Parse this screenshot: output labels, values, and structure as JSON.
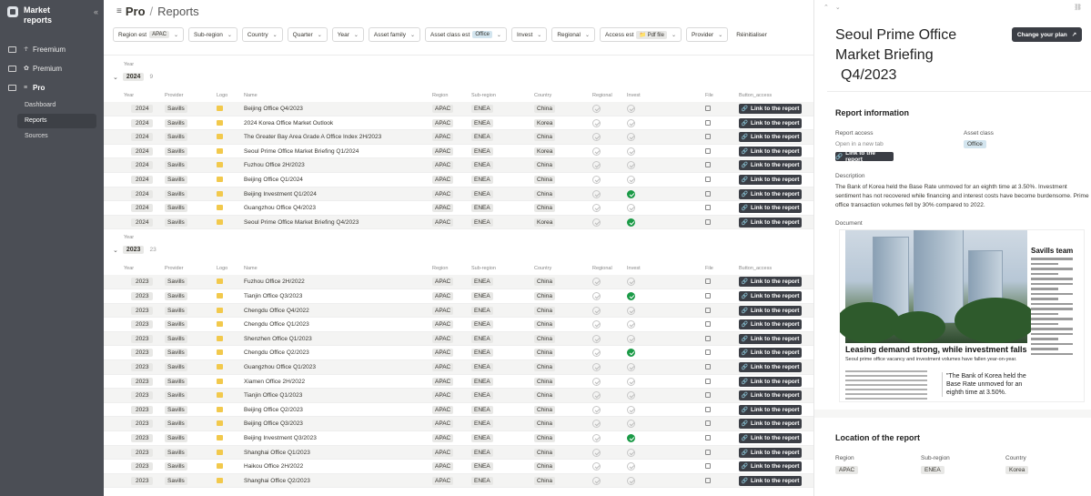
{
  "sidebar": {
    "title": "Market reports",
    "items": [
      {
        "label": "Freemium"
      },
      {
        "label": "Premium"
      },
      {
        "label": "Pro"
      }
    ],
    "subitems": [
      {
        "label": "Dashboard"
      },
      {
        "label": "Reports"
      },
      {
        "label": "Sources"
      }
    ]
  },
  "header": {
    "section": "Pro",
    "separator": "/",
    "page": "Reports"
  },
  "filters": [
    {
      "label": "Region est",
      "value": "APAC",
      "value_color": "gray"
    },
    {
      "label": "Sub-region",
      "value": ""
    },
    {
      "label": "Country",
      "value": ""
    },
    {
      "label": "Quarter",
      "value": ""
    },
    {
      "label": "Year",
      "value": ""
    },
    {
      "label": "Asset family",
      "value": ""
    },
    {
      "label": "Asset class est",
      "value": "Office",
      "value_color": "blue"
    },
    {
      "label": "Invest",
      "value": ""
    },
    {
      "label": "Regional",
      "value": ""
    },
    {
      "label": "Access est",
      "value": "📁 Pdf file",
      "value_color": "gray"
    },
    {
      "label": "Provider",
      "value": ""
    }
  ],
  "reset_label": "Réinitialiser",
  "columns": {
    "year": "Year",
    "provider": "Provider",
    "logo": "Logo",
    "name": "Name",
    "region": "Region",
    "subregion": "Sub-region",
    "country": "Country",
    "regional": "Regional",
    "invest": "Invest",
    "file": "File",
    "button": "Button_access"
  },
  "group_label": "Year",
  "button_label": "Link to the report",
  "groups": [
    {
      "year": "2024",
      "count": "9",
      "rows": [
        {
          "year": "2024",
          "provider": "Savills",
          "name": "Beijing Office Q4/2023",
          "region": "APAC",
          "subregion": "ENEA",
          "country": "China",
          "invest": false
        },
        {
          "year": "2024",
          "provider": "Savills",
          "name": "2024 Korea Office Market Outlook",
          "region": "APAC",
          "subregion": "ENEA",
          "country": "Korea",
          "invest": false
        },
        {
          "year": "2024",
          "provider": "Savills",
          "name": "The Greater Bay Area Grade A Office Index 2H/2023",
          "region": "APAC",
          "subregion": "ENEA",
          "country": "China",
          "invest": false
        },
        {
          "year": "2024",
          "provider": "Savills",
          "name": "Seoul Prime Office Market Briefing Q1/2024",
          "region": "APAC",
          "subregion": "ENEA",
          "country": "Korea",
          "invest": false
        },
        {
          "year": "2024",
          "provider": "Savills",
          "name": "Fuzhou Office 2H/2023",
          "region": "APAC",
          "subregion": "ENEA",
          "country": "China",
          "invest": false
        },
        {
          "year": "2024",
          "provider": "Savills",
          "name": "Beijing Office Q1/2024",
          "region": "APAC",
          "subregion": "ENEA",
          "country": "China",
          "invest": false
        },
        {
          "year": "2024",
          "provider": "Savills",
          "name": "Beijing Investment Q1/2024",
          "region": "APAC",
          "subregion": "ENEA",
          "country": "China",
          "invest": true
        },
        {
          "year": "2024",
          "provider": "Savills",
          "name": "Guangzhou Office Q4/2023",
          "region": "APAC",
          "subregion": "ENEA",
          "country": "China",
          "invest": false
        },
        {
          "year": "2024",
          "provider": "Savills",
          "name": "Seoul Prime Office Market Briefing Q4/2023",
          "region": "APAC",
          "subregion": "ENEA",
          "country": "Korea",
          "invest": true,
          "selected": true
        }
      ]
    },
    {
      "year": "2023",
      "count": "23",
      "rows": [
        {
          "year": "2023",
          "provider": "Savills",
          "name": "Fuzhou Office 2H/2022",
          "region": "APAC",
          "subregion": "ENEA",
          "country": "China",
          "invest": false
        },
        {
          "year": "2023",
          "provider": "Savills",
          "name": "Tianjin Office Q3/2023",
          "region": "APAC",
          "subregion": "ENEA",
          "country": "China",
          "invest": true
        },
        {
          "year": "2023",
          "provider": "Savills",
          "name": "Chengdu Office Q4/2022",
          "region": "APAC",
          "subregion": "ENEA",
          "country": "China",
          "invest": false
        },
        {
          "year": "2023",
          "provider": "Savills",
          "name": "Chengdu Office Q1/2023",
          "region": "APAC",
          "subregion": "ENEA",
          "country": "China",
          "invest": false
        },
        {
          "year": "2023",
          "provider": "Savills",
          "name": "Shenzhen Office Q1/2023",
          "region": "APAC",
          "subregion": "ENEA",
          "country": "China",
          "invest": false
        },
        {
          "year": "2023",
          "provider": "Savills",
          "name": "Chengdu Office Q2/2023",
          "region": "APAC",
          "subregion": "ENEA",
          "country": "China",
          "invest": true
        },
        {
          "year": "2023",
          "provider": "Savills",
          "name": "Guangzhou Office Q1/2023",
          "region": "APAC",
          "subregion": "ENEA",
          "country": "China",
          "invest": false
        },
        {
          "year": "2023",
          "provider": "Savills",
          "name": "Xiamen Office 2H/2022",
          "region": "APAC",
          "subregion": "ENEA",
          "country": "China",
          "invest": false
        },
        {
          "year": "2023",
          "provider": "Savills",
          "name": "Tianjin Office Q1/2023",
          "region": "APAC",
          "subregion": "ENEA",
          "country": "China",
          "invest": false
        },
        {
          "year": "2023",
          "provider": "Savills",
          "name": "Beijing Office Q2/2023",
          "region": "APAC",
          "subregion": "ENEA",
          "country": "China",
          "invest": false
        },
        {
          "year": "2023",
          "provider": "Savills",
          "name": "Beijing Office Q3/2023",
          "region": "APAC",
          "subregion": "ENEA",
          "country": "China",
          "invest": false
        },
        {
          "year": "2023",
          "provider": "Savills",
          "name": "Beijing Investment Q3/2023",
          "region": "APAC",
          "subregion": "ENEA",
          "country": "China",
          "invest": true
        },
        {
          "year": "2023",
          "provider": "Savills",
          "name": "Shanghai Office Q1/2023",
          "region": "APAC",
          "subregion": "ENEA",
          "country": "China",
          "invest": false
        },
        {
          "year": "2023",
          "provider": "Savills",
          "name": "Haikou Office 2H/2022",
          "region": "APAC",
          "subregion": "ENEA",
          "country": "China",
          "invest": false
        },
        {
          "year": "2023",
          "provider": "Savills",
          "name": "Shanghai Office Q2/2023",
          "region": "APAC",
          "subregion": "ENEA",
          "country": "China",
          "invest": false
        }
      ]
    }
  ],
  "panel": {
    "title": "Seoul Prime Office Market Briefing",
    "title_suffix": "Q4/2023",
    "change_plan": "Change your plan",
    "info_heading": "Report information",
    "report_access_label": "Report access",
    "open_new_tab": "Open in a new tab",
    "link_label": "Link to the report",
    "asset_class_label": "Asset class",
    "asset_class_value": "Office",
    "description_label": "Description",
    "description": "The Bank of Korea held the Base Rate unmoved for an eighth time at 3.50%. Investment sentiment has not recovered while financing and interest costs have become burdensome. Prime office transaction volumes fell by 30% compared to 2022.",
    "document_label": "Document",
    "doc_headline": "Leasing demand strong, while investment falls",
    "doc_subhead": "Seoul prime office vacancy and investment volumes have fallen year-on-year.",
    "doc_side_title": "Savills team",
    "doc_quote": "\"The Bank of Korea held the Base Rate unmoved for an eighth time at 3.50%.",
    "location_heading": "Location of the report",
    "region_label": "Region",
    "region_value": "APAC",
    "subregion_label": "Sub-region",
    "subregion_value": "ENEA",
    "country_label": "Country",
    "country_value": "Korea"
  },
  "colors": {
    "sidebar": "#4b4e55",
    "button": "#3b3e45",
    "check_on": "#1a9a46",
    "tag": "#e8e8e6",
    "tag_blue": "#d3e5ef"
  }
}
